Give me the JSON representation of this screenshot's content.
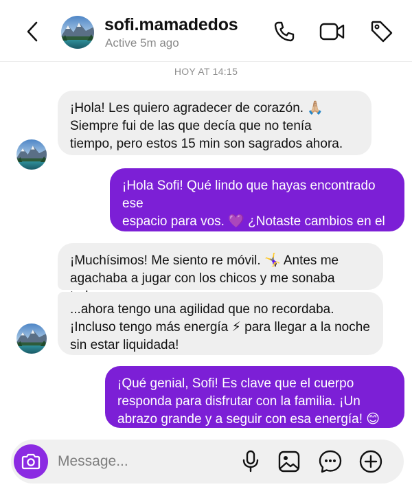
{
  "header": {
    "username": "sofi.mamadedos",
    "status": "Active 5m ago",
    "icons": [
      "back-chevron-icon",
      "phone-icon",
      "video-camera-icon",
      "tag-icon"
    ]
  },
  "timestamp": "HOY AT 14:15",
  "messages": [
    {
      "direction": "incoming",
      "text": "¡Hola! Les quiero agradecer de corazón. 🙏🏼\nSiempre fui de las que decía que no tenía\ntiempo, pero estos 15 min son sagrados ahora."
    },
    {
      "direction": "outgoing",
      "text": "¡Hola Sofi! Qué lindo que hayas encontrado ese\nespacio para vos. 💜 ¿Notaste cambios en el\ndía a día?"
    },
    {
      "direction": "incoming",
      "text": "¡Muchísimos! Me siento re móvil. 🤸‍♀️ Antes me\nagachaba a jugar con los chicos y me sonaba todo..."
    },
    {
      "direction": "incoming",
      "text": "...ahora tengo una agilidad que no recordaba.\n¡Incluso tengo más energía ⚡ para llegar a la noche\nsin estar liquidada!"
    },
    {
      "direction": "outgoing",
      "text": "¡Qué genial, Sofi! Es clave que el cuerpo\nresponda para disfrutar con la familia. ¡Un\nabrazo grande y a seguir con esa energía! 😊"
    }
  ],
  "composer": {
    "placeholder": "Message...",
    "value": "",
    "icons": [
      "camera-icon",
      "microphone-icon",
      "image-icon",
      "sticker-chat-icon",
      "plus-circle-icon"
    ]
  },
  "colors": {
    "outgoing_bubble": "#7c1fd6",
    "incoming_bubble": "#efefef",
    "camera_button": "#8b2be2"
  }
}
